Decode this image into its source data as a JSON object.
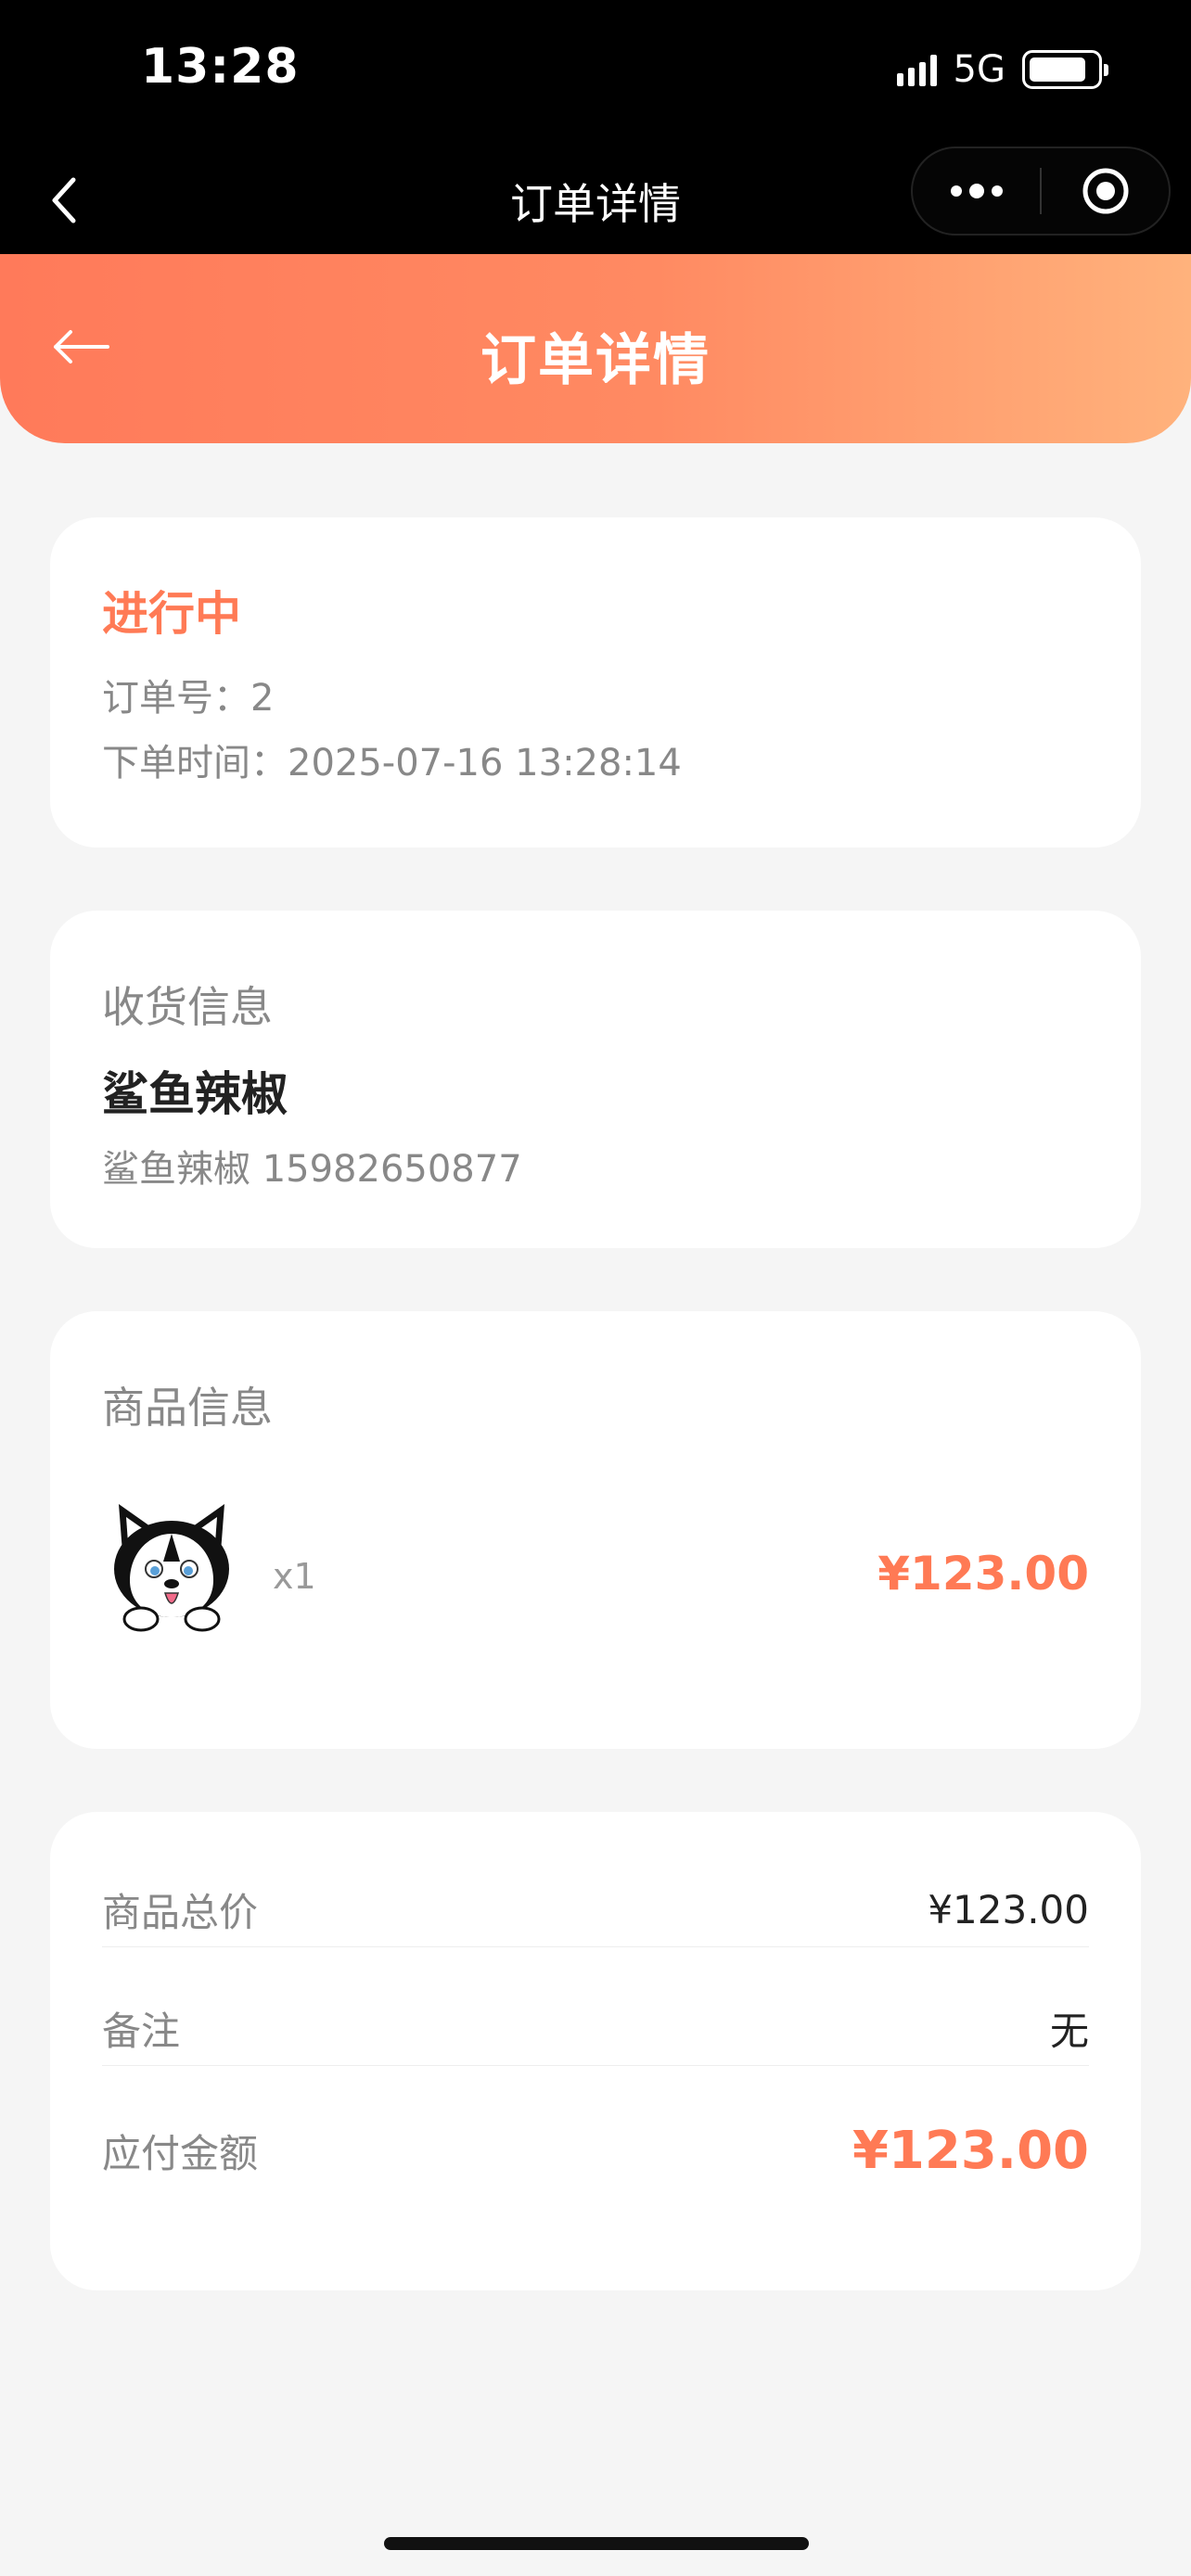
{
  "status_bar": {
    "time": "13:28",
    "network": "5G"
  },
  "nav": {
    "title": "订单详情"
  },
  "header": {
    "title": "订单详情"
  },
  "order": {
    "status": "进行中",
    "order_no": "订单号：2",
    "order_time": "下单时间：2025-07-16 13:28:14"
  },
  "receiver": {
    "section_title": "收货信息",
    "name": "鲨鱼辣椒",
    "detail": "鲨鱼辣椒 15982650877"
  },
  "goods": {
    "section_title": "商品信息",
    "quantity": "x1",
    "price": "¥123.00"
  },
  "summary": {
    "rows": [
      {
        "label": "商品总价",
        "value": "¥123.00"
      },
      {
        "label": "备注",
        "value": "无"
      },
      {
        "label": "应付金额",
        "value": "¥123.00"
      }
    ]
  },
  "colors": {
    "accent": "#ff7a55",
    "gradient_start": "#ff7a5a",
    "gradient_end": "#ffb27c"
  }
}
